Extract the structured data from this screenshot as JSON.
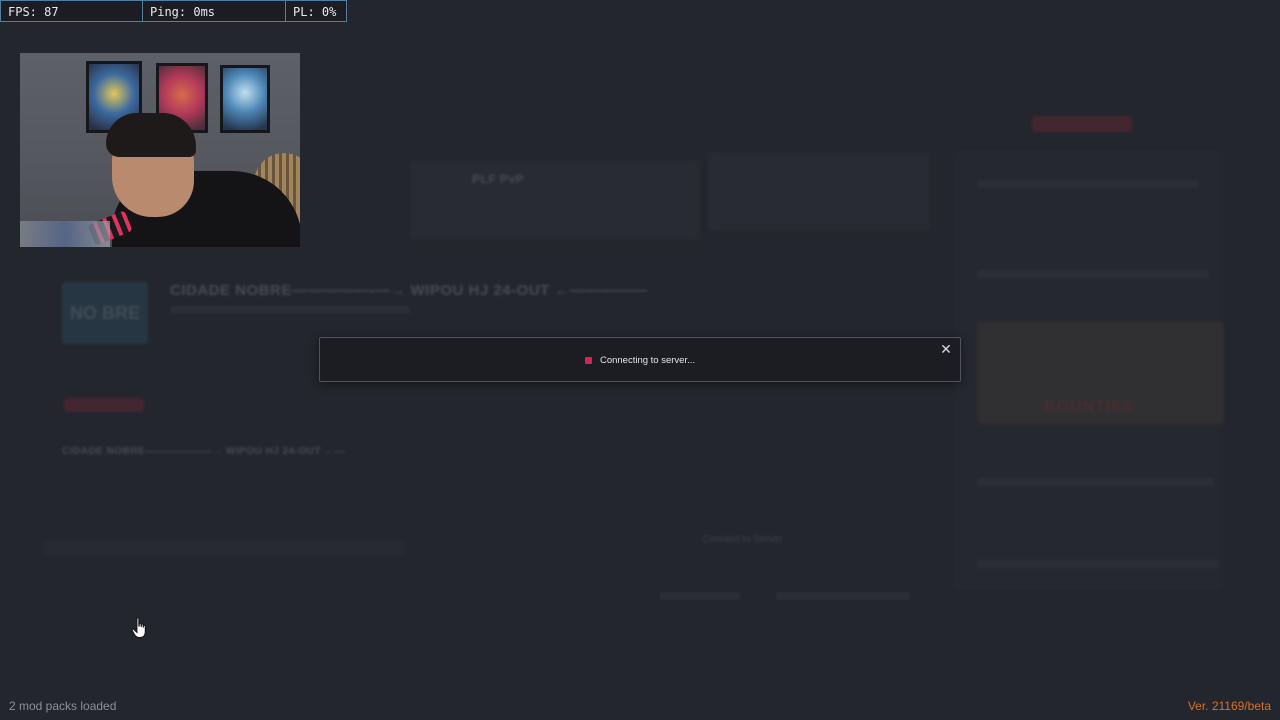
{
  "stats": {
    "fps": "FPS: 87",
    "ping": "Ping: 0ms",
    "pl": "PL: 0%"
  },
  "dialog": {
    "status_text": "Connecting to server...",
    "close_icon": "close-icon",
    "status_color": "#d8254a"
  },
  "background": {
    "server_title": "CIDADE NOBRE—————-—→ WIPOU HJ 24-OUT ←—————",
    "server_title_small": "CIDADE NOBRE—————-—→ WIPOU HJ 24-OUT ←—",
    "gamemode": "PLF PvP",
    "banner_text": "BOUNTIES",
    "logo_text": "NO BRE",
    "list_item": "Connect to Server"
  },
  "footer": {
    "mods_loaded": "2 mod packs loaded",
    "version": "Ver. 21169/beta"
  },
  "colors": {
    "background": "#24262d",
    "accent_version": "#d2722e",
    "stats_border": "#4f7fa2"
  },
  "icons": {
    "cursor": "hand-pointer-icon"
  }
}
